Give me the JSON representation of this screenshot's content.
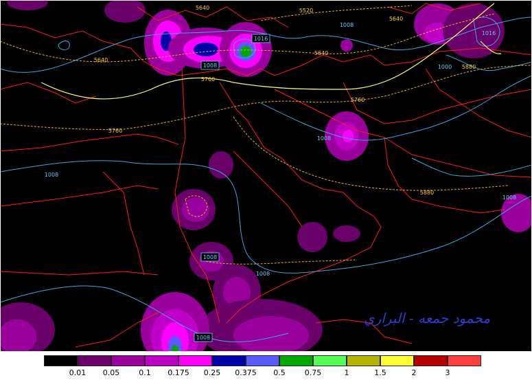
{
  "map": {
    "background": "#000000",
    "borders_color": "#ff1a1a",
    "isobar_color": "#3aa8e0",
    "height_color": "#e6b020",
    "isobar_labels": [
      "1008",
      "1008",
      "1008",
      "1016",
      "1008",
      "1008",
      "1008",
      "1000",
      "1008",
      "1008",
      "1016"
    ],
    "height_labels": [
      "5640",
      "5640",
      "5520",
      "5640",
      "5640",
      "5760",
      "5760",
      "5760",
      "5880",
      "5880"
    ],
    "watermark": "محمود جمعه - البراري",
    "watermark_color": "#2a3fd0"
  },
  "legend": {
    "colors": [
      "#000000",
      "#6a006a",
      "#99009c",
      "#c000c8",
      "#ff00ff",
      "#0000a8",
      "#5a5aff",
      "#00a800",
      "#55ff55",
      "#b4b400",
      "#ffff33",
      "#b40000",
      "#ff4040"
    ],
    "labels": [
      "0.01",
      "0.05",
      "0.1",
      "0.175",
      "0.25",
      "0.375",
      "0.5",
      "0.75",
      "1",
      "1.5",
      "2",
      "3"
    ]
  }
}
